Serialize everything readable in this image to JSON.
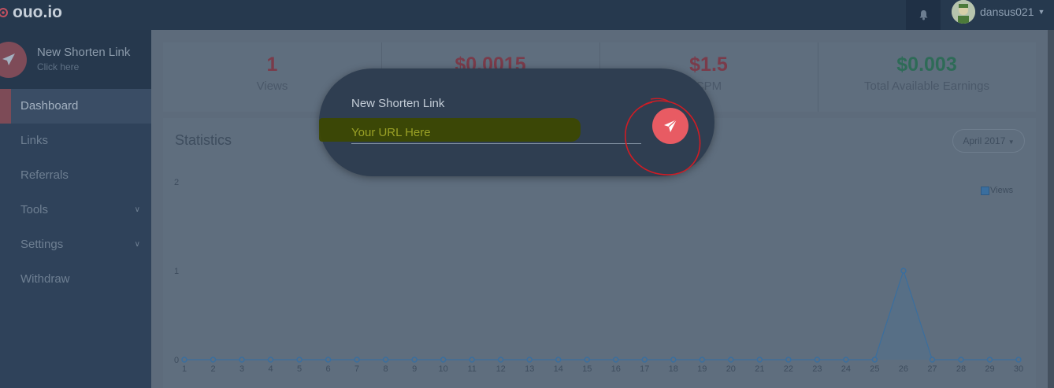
{
  "brand": {
    "name": "ouo.io"
  },
  "topbar": {
    "username": "dansus021"
  },
  "sidebar": {
    "new_link": {
      "title": "New Shorten Link",
      "subtitle": "Click here"
    },
    "items": [
      {
        "label": "Dashboard",
        "active": true
      },
      {
        "label": "Links"
      },
      {
        "label": "Referrals"
      },
      {
        "label": "Tools",
        "has_submenu": true
      },
      {
        "label": "Settings",
        "has_submenu": true
      },
      {
        "label": "Withdraw"
      }
    ]
  },
  "stats": [
    {
      "value": "1",
      "label": "Views",
      "color": "#7a3b4a"
    },
    {
      "value": "$0.0015",
      "label": "",
      "color": "#7a3b4a"
    },
    {
      "value": "$1.5",
      "label": "CPM",
      "color": "#7a3b4a"
    },
    {
      "value": "$0.003",
      "label": "Total Available Earnings",
      "color": "#2e6b57"
    }
  ],
  "statistics_panel": {
    "title": "Statistics",
    "month_selector": "April 2017"
  },
  "modal": {
    "title": "New Shorten Link",
    "url_placeholder": "Your URL Here",
    "send_icon": "paper-plane-icon"
  },
  "colors": {
    "accent_red": "#e85b63",
    "sidebar_bg": "#2f425a",
    "topbar_bg": "#26394e"
  },
  "chart_data": {
    "type": "line",
    "legend": [
      "Views"
    ],
    "legend_position": "top-right",
    "x": [
      1,
      2,
      3,
      4,
      5,
      6,
      7,
      8,
      9,
      10,
      11,
      12,
      13,
      14,
      15,
      16,
      17,
      18,
      19,
      20,
      21,
      22,
      23,
      24,
      25,
      26,
      27,
      28,
      29,
      30
    ],
    "series": [
      {
        "name": "Views",
        "values": [
          0,
          0,
          0,
          0,
          0,
          0,
          0,
          0,
          0,
          0,
          0,
          0,
          0,
          0,
          0,
          0,
          0,
          0,
          0,
          0,
          0,
          0,
          0,
          0,
          0,
          1,
          0,
          0,
          0,
          0
        ]
      }
    ],
    "yticks": [
      0,
      1,
      2
    ],
    "ylim": [
      0,
      2
    ],
    "grid": false
  }
}
